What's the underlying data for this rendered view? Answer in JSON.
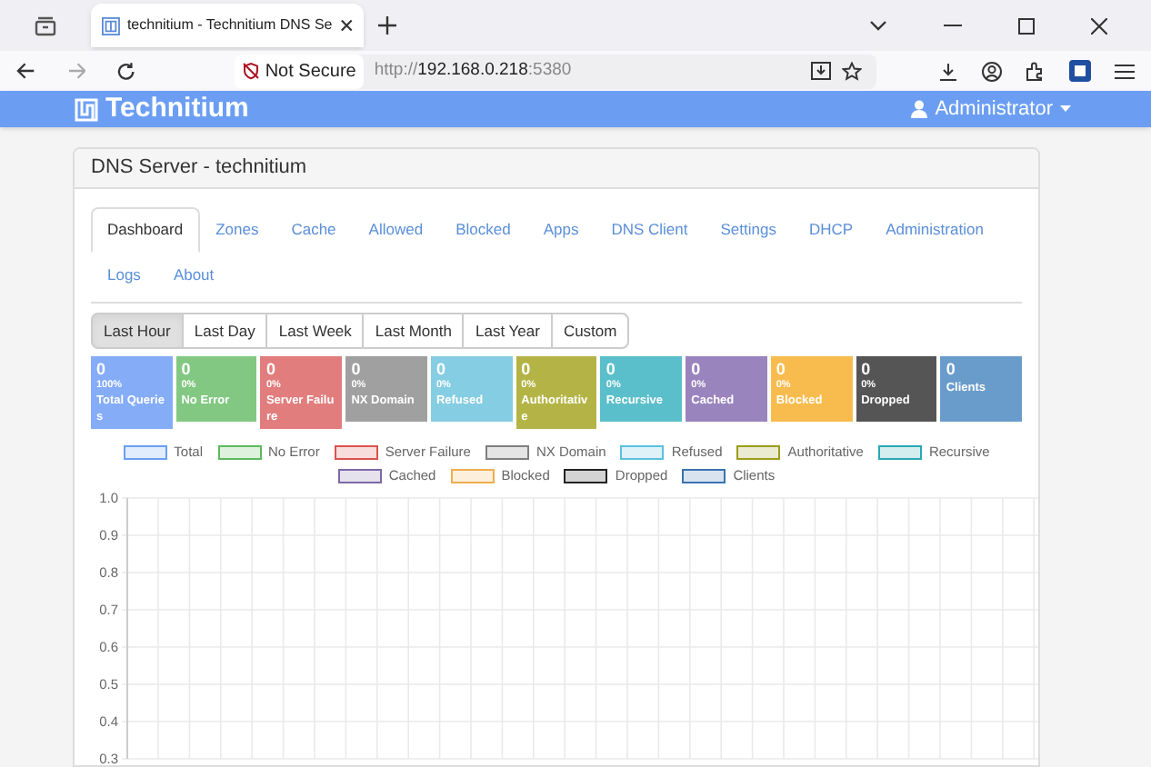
{
  "browser": {
    "tab_title": "technitium - Technitium DNS Se",
    "security": "Not Secure",
    "url": {
      "scheme": "http://",
      "host": "192.168.0.218",
      "port": ":5380"
    }
  },
  "app": {
    "brand": "Technitium",
    "user": "Administrator"
  },
  "panel": {
    "title": "DNS Server - technitium"
  },
  "tabs": [
    {
      "label": "Dashboard",
      "selected": true
    },
    {
      "label": "Zones",
      "selected": false
    },
    {
      "label": "Cache",
      "selected": false
    },
    {
      "label": "Allowed",
      "selected": false
    },
    {
      "label": "Blocked",
      "selected": false
    },
    {
      "label": "Apps",
      "selected": false
    },
    {
      "label": "DNS Client",
      "selected": false
    },
    {
      "label": "Settings",
      "selected": false
    },
    {
      "label": "DHCP",
      "selected": false
    },
    {
      "label": "Administration",
      "selected": false
    },
    {
      "label": "Logs",
      "selected": false
    },
    {
      "label": "About",
      "selected": false
    }
  ],
  "ranges": [
    {
      "label": "Last Hour",
      "selected": true
    },
    {
      "label": "Last Day",
      "selected": false
    },
    {
      "label": "Last Week",
      "selected": false
    },
    {
      "label": "Last Month",
      "selected": false
    },
    {
      "label": "Last Year",
      "selected": false
    },
    {
      "label": "Custom",
      "selected": false
    }
  ],
  "stats": [
    {
      "value": "0",
      "percent": "100%",
      "label": "Total Queries",
      "color": "#85acf7"
    },
    {
      "value": "0",
      "percent": "0%",
      "label": "No Error",
      "color": "#82c882"
    },
    {
      "value": "0",
      "percent": "0%",
      "label": "Server Failure",
      "color": "#e27d7d"
    },
    {
      "value": "0",
      "percent": "0%",
      "label": "NX Domain",
      "color": "#a0a0a0"
    },
    {
      "value": "0",
      "percent": "0%",
      "label": "Refused",
      "color": "#85cde2"
    },
    {
      "value": "0",
      "percent": "0%",
      "label": "Authoritative",
      "color": "#b4b446"
    },
    {
      "value": "0",
      "percent": "0%",
      "label": "Recursive",
      "color": "#5bbfcb"
    },
    {
      "value": "0",
      "percent": "0%",
      "label": "Cached",
      "color": "#9a84bd"
    },
    {
      "value": "0",
      "percent": "0%",
      "label": "Blocked",
      "color": "#f8bc4e"
    },
    {
      "value": "0",
      "percent": "0%",
      "label": "Dropped",
      "color": "#555555"
    },
    {
      "value": "0",
      "label": "Clients",
      "color": "#6a9ccb"
    }
  ],
  "chart_data": {
    "type": "line",
    "grid": true,
    "ylim": [
      0.3,
      1
    ],
    "yticks": [
      {
        "value": 1,
        "label": "1.0"
      },
      {
        "value": 0.9,
        "label": "0.9"
      },
      {
        "value": 0.8,
        "label": "0.8"
      },
      {
        "value": 0.7,
        "label": "0.7"
      },
      {
        "value": 0.6,
        "label": "0.6"
      },
      {
        "value": 0.5,
        "label": "0.5"
      },
      {
        "value": 0.4,
        "label": "0.4"
      },
      {
        "value": 0.3,
        "label": "0.3"
      }
    ],
    "series": [
      {
        "name": "Total",
        "color": "#6a9ff0"
      },
      {
        "name": "No Error",
        "color": "#5cb85c"
      },
      {
        "name": "Server Failure",
        "color": "#d9534f"
      },
      {
        "name": "NX Domain",
        "color": "#7f7f7f"
      },
      {
        "name": "Refused",
        "color": "#5bc0de"
      },
      {
        "name": "Authoritative",
        "color": "#9c9c1a"
      },
      {
        "name": "Recursive",
        "color": "#2aa8b4"
      },
      {
        "name": "Cached",
        "color": "#7d68a6"
      },
      {
        "name": "Blocked",
        "color": "#f0ad4e"
      },
      {
        "name": "Dropped",
        "color": "#222222"
      },
      {
        "name": "Clients",
        "color": "#3a72b0"
      }
    ]
  }
}
